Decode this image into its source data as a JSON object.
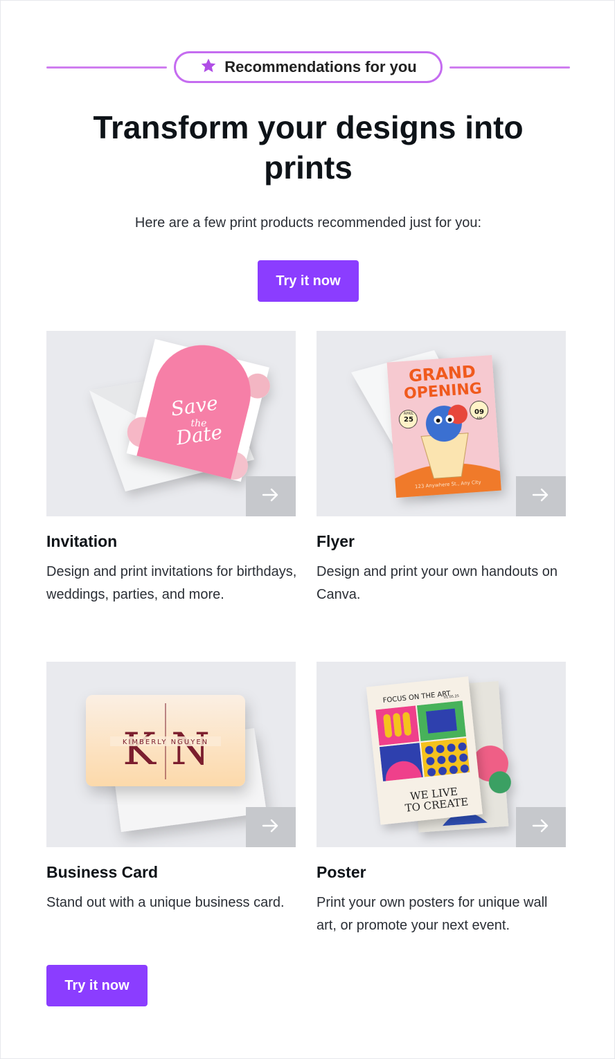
{
  "header": {
    "badge_label": "Recommendations for you",
    "badge_icon": "star-icon",
    "accent_color": "#c56cf0"
  },
  "hero": {
    "headline": "Transform your designs into prints",
    "subtitle": "Here are a few print products recommended just for you:",
    "cta_label": "Try it now"
  },
  "products": [
    {
      "title": "Invitation",
      "description": "Design and print invitations for birthdays, weddings, parties, and more.",
      "image_text": [
        "Save",
        "the",
        "Date"
      ],
      "arrow_icon": "arrow-right-icon"
    },
    {
      "title": "Flyer",
      "description": "Design and print your own handouts on Canva.",
      "image_text": [
        "GRAND",
        "OPENING",
        "APRIL",
        "25",
        "09",
        "AM",
        "123 Anywhere St., Any City"
      ],
      "arrow_icon": "arrow-right-icon"
    },
    {
      "title": "Business Card",
      "description": "Stand out with a unique business card.",
      "image_text": [
        "K",
        "N",
        "KIMBERLY NGUYEN"
      ],
      "arrow_icon": "arrow-right-icon"
    },
    {
      "title": "Poster",
      "description": "Print your own posters for unique wall art, or promote your next event.",
      "image_text": [
        "FOCUS ON THE ART",
        "01.05.25",
        "WE LIVE",
        "TO CREATE"
      ],
      "arrow_icon": "arrow-right-icon"
    }
  ],
  "footer": {
    "cta_label": "Try it now"
  },
  "colors": {
    "button": "#8b3dff",
    "thumb_bg": "#e9eaee"
  }
}
